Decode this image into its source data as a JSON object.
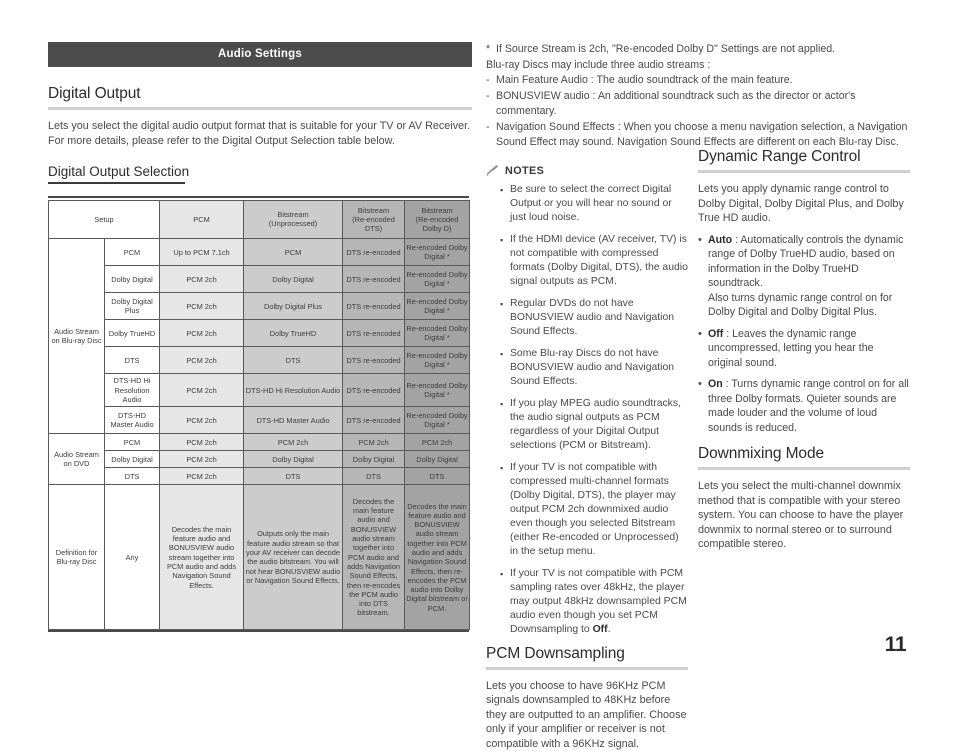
{
  "banner": {
    "title": "Audio Settings"
  },
  "left": {
    "heading": "Digital Output",
    "intro": "Lets you select the digital audio output format that is suitable for your TV or AV Receiver. For more details, please refer to the Digital Output Selection table below.",
    "subheading": "Digital Output Selection",
    "table": {
      "headers": [
        "Setup",
        "PCM",
        "Bitstream\n(Unprocessed)",
        "Bitstream\n(Re-encoded DTS)",
        "Bitstream\n(Re-encoded Dolby D)"
      ],
      "header_setup": "Setup",
      "header_pcm": "PCM",
      "header_bsu_l1": "Bitstream",
      "header_bsu_l2": "(Unprocessed)",
      "header_bsdts_l1": "Bitstream",
      "header_bsdts_l2": "(Re-encoded",
      "header_bsdts_l3": "DTS)",
      "header_bsdd_l1": "Bitstream",
      "header_bsdd_l2": "(Re-encoded",
      "header_bsdd_l3": "Dolby D)",
      "group_bluray": "Audio Stream on Blu-ray Disc",
      "group_dvd": "Audio Stream on DVD",
      "group_def": "Definition for Blu-ray Disc",
      "bluray_rows": [
        {
          "setup": "PCM",
          "pcm": "Up to PCM 7.1ch",
          "bsu": "PCM",
          "bsdts": "DTS re-encoded",
          "bsdd": "Re-encoded Dolby Digital *"
        },
        {
          "setup": "Dolby Digital",
          "pcm": "PCM 2ch",
          "bsu": "Dolby Digital",
          "bsdts": "DTS re-encoded",
          "bsdd": "Re-encoded Dolby Digital *"
        },
        {
          "setup": "Dolby Digital Plus",
          "pcm": "PCM 2ch",
          "bsu": "Dolby Digital Plus",
          "bsdts": "DTS re-encoded",
          "bsdd": "Re-encoded Dolby Digital *"
        },
        {
          "setup": "Dolby TrueHD",
          "pcm": "PCM 2ch",
          "bsu": "Dolby TrueHD",
          "bsdts": "DTS re-encoded",
          "bsdd": "Re-encoded Dolby Digital *"
        },
        {
          "setup": "DTS",
          "pcm": "PCM 2ch",
          "bsu": "DTS",
          "bsdts": "DTS re-encoded",
          "bsdd": "Re-encoded Dolby Digital *"
        },
        {
          "setup": "DTS-HD Hi Resolution Audio",
          "pcm": "PCM 2ch",
          "bsu": "DTS-HD Hi Resolution Audio",
          "bsdts": "DTS re-encoded",
          "bsdd": "Re-encoded Dolby Digital *"
        },
        {
          "setup": "DTS-HD Master Audio",
          "pcm": "PCM 2ch",
          "bsu": "DTS-HD Master Audio",
          "bsdts": "DTS re-encoded",
          "bsdd": "Re-encoded Dolby Digital *"
        }
      ],
      "dvd_rows": [
        {
          "setup": "PCM",
          "pcm": "PCM 2ch",
          "bsu": "PCM 2ch",
          "bsdts": "PCM 2ch",
          "bsdd": "PCM 2ch"
        },
        {
          "setup": "Dolby Digital",
          "pcm": "PCM 2ch",
          "bsu": "Dolby Digital",
          "bsdts": "Dolby Digital",
          "bsdd": "Dolby Digital"
        },
        {
          "setup": "DTS",
          "pcm": "PCM 2ch",
          "bsu": "DTS",
          "bsdts": "DTS",
          "bsdd": "DTS"
        }
      ],
      "definition_row": {
        "setup": "Any",
        "pcm": "Decodes the main feature audio and BONUSVIEW audio stream together into PCM audio and adds Navigation Sound Effects.",
        "bsu": "Outputs only the main feature audio stream so that your AV receiver can decode the audio bitstream. You will not hear BONUSVIEW audio or Navigation Sound Effects.",
        "bsdts": "Decodes the main feature audio and BONUSVIEW audio stream together into PCM audio and adds Navigation Sound Effects, then re-encodes the PCM audio into DTS bitstream.",
        "bsdd": "Decodes the main feature audio and BONUSVIEW audio stream together into PCM audio and adds Navigation Sound Effects, then re-encodes the PCM audio into Dolby Digital bitstream or PCM."
      }
    }
  },
  "footnote": {
    "mark": "*",
    "line1": "If Source Stream is 2ch, \"Re-encoded Dolby D\" Settings are not applied.",
    "line2": "Blu-ray Discs may include three audio streams :",
    "dash": "-",
    "item1": "Main Feature Audio : The audio soundtrack of the main feature.",
    "item2": "BONUSVIEW audio : An additional soundtrack such as the director or actor's commentary.",
    "item3": "Navigation Sound Effects : When you choose a menu navigation selection, a Navigation Sound Effect may sound. Navigation Sound Effects are different on each Blu-ray Disc."
  },
  "notes": {
    "icon": "pencil-icon",
    "title": "NOTES",
    "bullet": "▪",
    "items": [
      "Be sure to select the correct Digital Output or you will hear no sound or just loud noise.",
      "If the HDMI device (AV receiver, TV) is not compatible with compressed formats (Dolby Digital, DTS), the audio signal outputs as PCM.",
      "Regular DVDs do not have BONUSVIEW audio and Navigation Sound Effects.",
      "Some Blu-ray Discs do not have BONUSVIEW audio and Navigation Sound Effects.",
      "If you play MPEG audio soundtracks, the audio signal outputs as PCM regardless of your Digital Output selections (PCM or Bitstream).",
      "If your TV is not compatible with compressed multi-channel formats (Dolby Digital, DTS), the player may output PCM 2ch downmixed audio even though you selected Bitstream (either Re-encoded or Unprocessed) in the setup menu."
    ],
    "last_item_prefix": "If your TV is not compatible with PCM sampling rates over 48kHz, the player may output 48kHz downsampled PCM audio even though you set PCM Downsampling to ",
    "last_item_bold": "Off",
    "last_item_suffix": "."
  },
  "pcm_downsampling": {
    "heading": "PCM Downsampling",
    "body": "Lets you choose to have 96KHz PCM signals downsampled to 48KHz before they are outputted to an amplifier. Choose only if your amplifier or receiver is not compatible with a 96KHz signal."
  },
  "dynamic_range": {
    "heading": "Dynamic Range Control",
    "body": "Lets you apply dynamic range control to Dolby Digital, Dolby Digital Plus, and Dolby True HD audio.",
    "bullet": "•",
    "items": [
      {
        "label": "Auto",
        "text": " : Automatically controls the dynamic range of Dolby TrueHD audio, based on information in the Dolby TrueHD soundtrack.",
        "extra": "Also turns dynamic range control on for Dolby Digital and Dolby Digital Plus."
      },
      {
        "label": "Off",
        "text": " : Leaves the dynamic range uncompressed, letting you hear the original sound.",
        "extra": ""
      },
      {
        "label": "On",
        "text": " : Turns dynamic range control on for all three Dolby formats. Quieter sounds are made louder and the volume of loud sounds is reduced.",
        "extra": ""
      }
    ]
  },
  "downmixing": {
    "heading": "Downmixing Mode",
    "body": "Lets you select the multi-channel downmix method that is compatible with your stereo system. You can choose to have the player downmix to normal stereo or to surround compatible stereo."
  },
  "page": {
    "number": "11"
  }
}
